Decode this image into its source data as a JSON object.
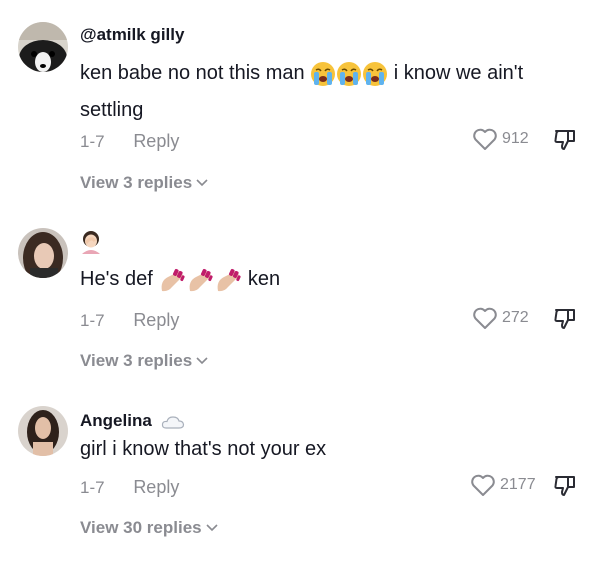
{
  "comments": [
    {
      "username": "@atmilk  gilly",
      "text_part1": "ken babe no not this man",
      "text_part2": "i know we ain't",
      "text_line2": "settling",
      "date": "1-7",
      "reply_label": "Reply",
      "likes": "912",
      "view_replies": "View 3 replies",
      "inline_emojis": [
        "loudly-crying-face",
        "loudly-crying-face",
        "loudly-crying-face"
      ]
    },
    {
      "username_emoji": "person-facepalming",
      "text_part1": "He's def",
      "text_part2": "ken",
      "date": "1-7",
      "reply_label": "Reply",
      "likes": "272",
      "view_replies": "View 3 replies",
      "inline_emojis": [
        "nail-polish",
        "nail-polish",
        "nail-polish"
      ]
    },
    {
      "username": "Angelina",
      "username_emoji": "cloud",
      "text": "girl i know that's not your ex",
      "date": "1-7",
      "reply_label": "Reply",
      "likes": "2177",
      "view_replies": "View 30 replies"
    }
  ],
  "colors": {
    "secondary_text": "#8a8b91",
    "primary_text": "#161823",
    "background": "#ffffff"
  },
  "icons": {
    "like": "heart-outline-icon",
    "dislike": "thumbs-down-icon",
    "expand": "chevron-down-icon"
  }
}
